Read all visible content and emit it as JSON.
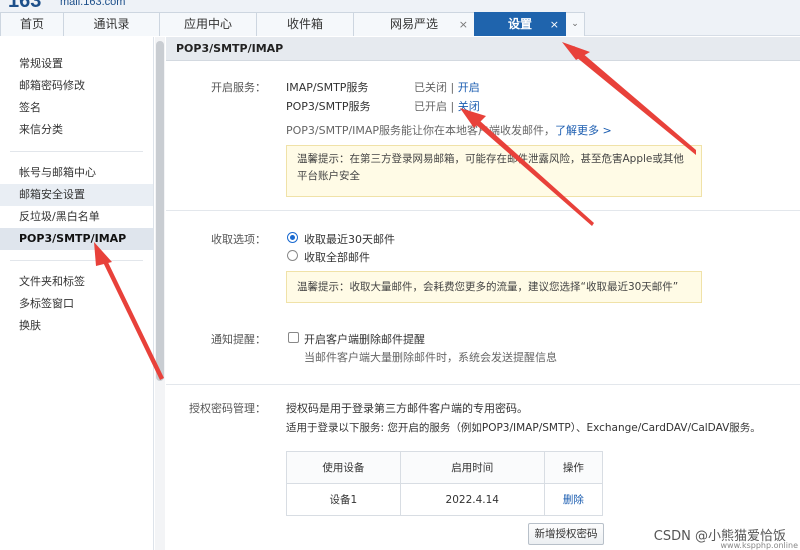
{
  "logo": {
    "number": "163",
    "domain": "mail.163.com"
  },
  "tabs": [
    {
      "label": "首页",
      "closable": false
    },
    {
      "label": "通讯录",
      "closable": false
    },
    {
      "label": "应用中心",
      "closable": false
    },
    {
      "label": "收件箱",
      "closable": false
    },
    {
      "label": "网易严选",
      "closable": true,
      "close": "×"
    },
    {
      "label": "设置",
      "closable": true,
      "active": true,
      "close": "×"
    }
  ],
  "tab_more": "⌄",
  "sidebar": {
    "group1": [
      "常规设置",
      "邮箱密码修改",
      "签名",
      "来信分类"
    ],
    "group2": [
      "帐号与邮箱中心",
      "邮箱安全设置",
      "反垃圾/黑白名单",
      "POP3/SMTP/IMAP"
    ],
    "group3": [
      "文件夹和标签",
      "多标签窗口",
      "换肤"
    ]
  },
  "main": {
    "header": "POP3/SMTP/IMAP",
    "service": {
      "label": "开启服务：",
      "rows": [
        {
          "name": "IMAP/SMTP服务",
          "status": "已关闭",
          "sep": "|",
          "action": "开启"
        },
        {
          "name": "POP3/SMTP服务",
          "status": "已开启",
          "sep": "|",
          "action": "关闭"
        }
      ],
      "desc": "POP3/SMTP/IMAP服务能让你在本地客户端收发邮件，",
      "learn_more": "了解更多 >",
      "tip_line1": "温馨提示：在第三方登录网易邮箱，可能存在邮件泄露风险，甚至危害Apple或其他",
      "tip_line2": "平台账户安全"
    },
    "receive": {
      "label": "收取选项：",
      "option1": "收取最近30天邮件",
      "option2": "收取全部邮件",
      "tip": "温馨提示：收取大量邮件，会耗费您更多的流量，建议您选择“收取最近30天邮件”"
    },
    "notify": {
      "label": "通知提醒：",
      "option": "开启客户端删除邮件提醒",
      "desc": "当邮件客户端大量删除邮件时，系统会发送提醒信息"
    },
    "auth": {
      "label": "授权密码管理：",
      "desc1": "授权码是用于登录第三方邮件客户端的专用密码。",
      "desc2": "适用于登录以下服务: 您开启的服务（例如POP3/IMAP/SMTP）、Exchange/CardDAV/CalDAV服务。",
      "headers": [
        "使用设备",
        "启用时间",
        "操作"
      ],
      "row": {
        "device": "设备1",
        "time": "2022.4.14",
        "action": "删除"
      },
      "new_button": "新增授权密码"
    }
  },
  "watermark": "CSDN @小熊猫爱恰饭",
  "watermark_url": "www.kspphp.online",
  "colors": {
    "accent": "#1f64ad",
    "link": "#1a5cb0",
    "arrow": "#e8413a"
  }
}
